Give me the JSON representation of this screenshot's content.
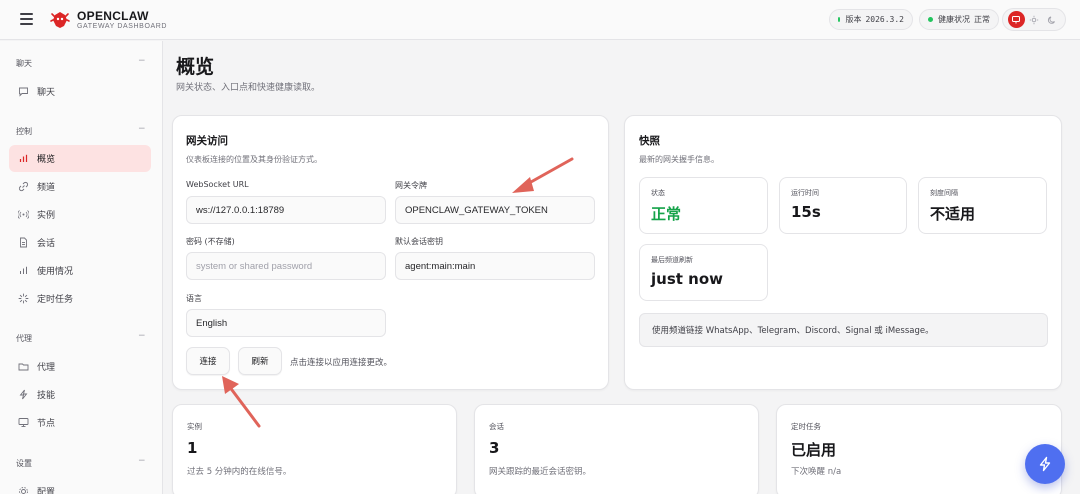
{
  "header": {
    "brand_title": "OPENCLAW",
    "brand_subtitle": "GATEWAY DASHBOARD",
    "version_label": "版本",
    "version_value": "2026.3.2",
    "health_label": "健康状况",
    "health_value": "正常"
  },
  "sidebar": {
    "sections": [
      {
        "label": "聊天",
        "items": [
          "聊天"
        ]
      },
      {
        "label": "控制",
        "items": [
          "概览",
          "频道",
          "实例",
          "会话",
          "使用情况",
          "定时任务"
        ]
      },
      {
        "label": "代理",
        "items": [
          "代理",
          "技能",
          "节点"
        ]
      },
      {
        "label": "设置",
        "items": [
          "配置"
        ]
      }
    ],
    "collapse_symbol": "−"
  },
  "page": {
    "title": "概览",
    "subtitle": "网关状态、入口点和快速健康读取。"
  },
  "gateway_access": {
    "title": "网关访问",
    "subtitle": "仪表板连接的位置及其身份验证方式。",
    "ws_label": "WebSocket URL",
    "ws_value": "ws://127.0.0.1:18789",
    "token_label": "网关令牌",
    "token_value": "OPENCLAW_GATEWAY_TOKEN",
    "password_label": "密码 (不存储)",
    "password_placeholder": "system or shared password",
    "session_label": "默认会话密钥",
    "session_value": "agent:main:main",
    "language_label": "语言",
    "language_value": "English",
    "connect_label": "连接",
    "refresh_label": "刷新",
    "hint": "点击连接以应用连接更改。"
  },
  "snapshot": {
    "title": "快照",
    "subtitle": "最新的网关握手信息。",
    "stats": [
      {
        "label": "状态",
        "value": "正常"
      },
      {
        "label": "运行时间",
        "value": "15s"
      },
      {
        "label": "刻度间隔",
        "value": "不适用"
      },
      {
        "label": "最后频道刷新",
        "value": "just now"
      }
    ],
    "note": "使用频道链接 WhatsApp、Telegram、Discord、Signal 或 iMessage。"
  },
  "bottom_cards": [
    {
      "label": "实例",
      "value": "1",
      "sub": "过去 5 分钟内的在线信号。"
    },
    {
      "label": "会话",
      "value": "3",
      "sub": "网关跟踪的最近会话密钥。"
    },
    {
      "label": "定时任务",
      "value": "已启用",
      "sub": "下次唤醒 n/a"
    }
  ],
  "colors": {
    "accent_red": "#dc2626",
    "active_nav_bg": "#fde2e2",
    "status_green": "#16a34a",
    "fab_blue": "#4f6ff0",
    "annotation_arrow": "#e0645a"
  }
}
